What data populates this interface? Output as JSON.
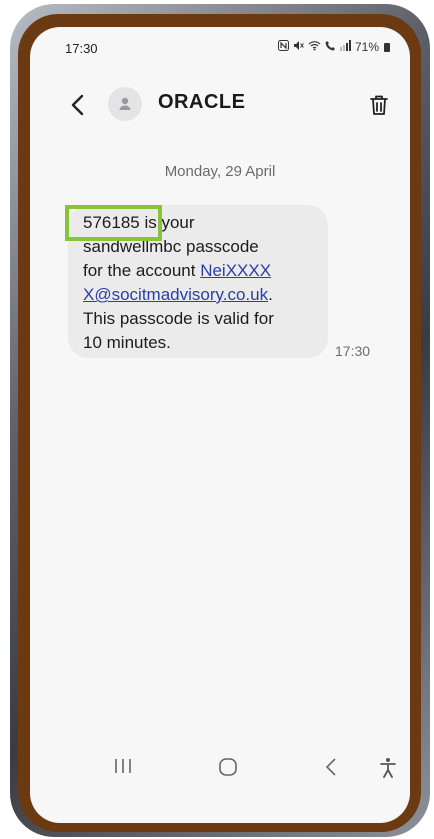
{
  "status_bar": {
    "time": "17:30",
    "battery": "71%",
    "icons": [
      "nfc-icon",
      "mute-icon",
      "wifi-icon",
      "call-wifi-icon",
      "signal-icon",
      "battery-icon"
    ]
  },
  "header": {
    "contact_name": "ORACLE",
    "icons": [
      "back-arrow-icon",
      "contact-avatar-icon",
      "trash-icon"
    ]
  },
  "conversation": {
    "date": "Monday, 29 April",
    "message": {
      "code": "576185",
      "lines": [
        " is your",
        "sandwellmbc passcode",
        "for the account "
      ],
      "link_part1": "NeiXXXX",
      "link_part2": "X@socitmadvisory.co.uk",
      "after_link": ".",
      "line5": "This passcode is valid for",
      "line6": "10 minutes.",
      "time": "17:30"
    },
    "highlight_color": "#86c53a"
  },
  "nav_bar": {
    "icons": [
      "recent-apps-icon",
      "home-icon",
      "back-icon",
      "accessibility-icon"
    ]
  },
  "colors": {
    "link": "#2a3fa4",
    "bubble": "#ebebeb",
    "background": "#f7f7f7"
  }
}
